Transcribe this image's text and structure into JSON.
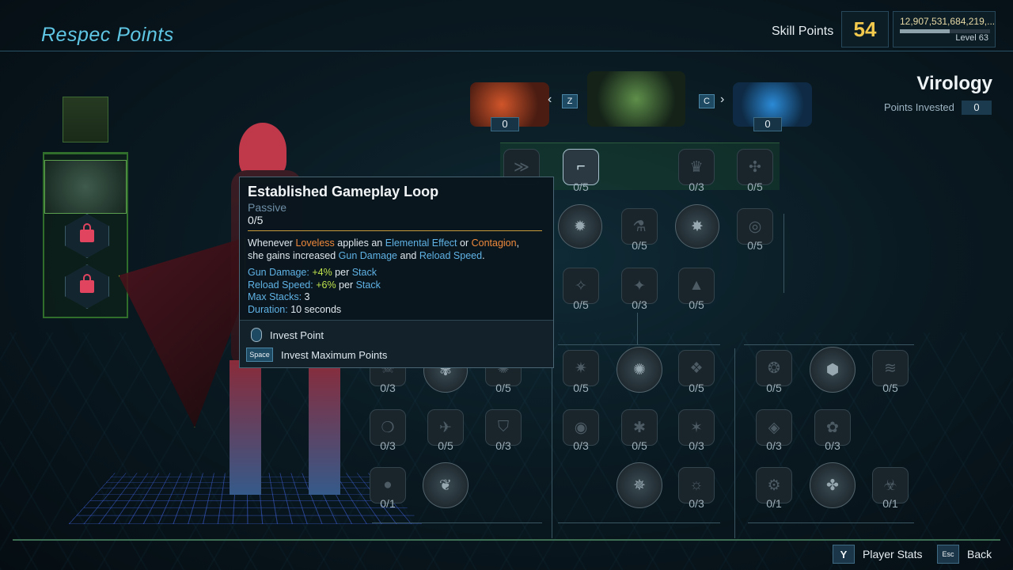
{
  "header": {
    "title": "Respec Points",
    "skill_points_label": "Skill Points",
    "skill_points_value": "54",
    "xp_value": "12,907,531,684,219,...",
    "xp_progress": 0.55,
    "level": "Level 63"
  },
  "tree": {
    "name": "Virology",
    "points_invested_label": "Points Invested",
    "points_invested_value": "0"
  },
  "action_skills": {
    "left_count": "0",
    "right_count": "0",
    "prev_key": "Z",
    "next_key": "C"
  },
  "tooltip": {
    "title": "Established Gameplay Loop",
    "type": "Passive",
    "rank": "0/5",
    "desc_1": "Whenever ",
    "desc_loveless": "Loveless",
    "desc_2": " applies an ",
    "desc_elemental": "Elemental Effect",
    "desc_3": " or ",
    "desc_contagion": "Contagion",
    "desc_4": ",",
    "desc_5": "she gains increased ",
    "desc_gun": "Gun Damage",
    "desc_6": " and ",
    "desc_reload": "Reload Speed",
    "desc_7": ".",
    "stat1_key": "Gun Damage:",
    "stat1_val": "+4%",
    "stat1_per": " per ",
    "stat1_stack": "Stack",
    "stat2_key": "Reload Speed:",
    "stat2_val": "+6%",
    "stat2_per": " per ",
    "stat2_stack": "Stack",
    "stat3_key": "Max Stacks:",
    "stat3_val": " 3",
    "stat4_key": "Duration:",
    "stat4_val": " 10 seconds",
    "invest_point": "Invest Point",
    "space_key": "Space",
    "invest_max": "Invest Maximum Points"
  },
  "nodes": [
    {
      "id": "r0a",
      "count": "0/5",
      "icon": "gun-icon",
      "glyph": "⌐"
    },
    {
      "id": "r0b",
      "count": "0/3",
      "icon": "crown-icon",
      "glyph": "♛"
    },
    {
      "id": "r0c",
      "count": "0/5",
      "icon": "triskelion-icon",
      "glyph": "✣"
    },
    {
      "id": "r1a",
      "count": "0/5",
      "icon": "flask-icon",
      "glyph": "⚗"
    },
    {
      "id": "r1b",
      "count": "0/5",
      "icon": "target-icon",
      "glyph": "◎"
    },
    {
      "id": "r2a",
      "count": "0/5",
      "icon": "compass-icon",
      "glyph": "✧"
    },
    {
      "id": "r2b",
      "count": "0/3",
      "icon": "claw-icon",
      "glyph": "✦"
    },
    {
      "id": "r2c",
      "count": "0/5",
      "icon": "flame-icon",
      "glyph": "▲"
    },
    {
      "id": "r3a",
      "count": "0/3",
      "icon": "skull-icon",
      "glyph": "☠"
    },
    {
      "id": "r3b",
      "count": "0/5",
      "icon": "burst-icon",
      "glyph": "✺"
    },
    {
      "id": "r3c",
      "count": "0/5",
      "icon": "bolt-icon",
      "glyph": "✷"
    },
    {
      "id": "r3d",
      "count": "0/5",
      "icon": "spike-icon",
      "glyph": "❖"
    },
    {
      "id": "r3e",
      "count": "0/5",
      "icon": "ring-icon",
      "glyph": "❂"
    },
    {
      "id": "r3f",
      "count": "0/5",
      "icon": "dash-icon",
      "glyph": "≋"
    },
    {
      "id": "r4a",
      "count": "0/3",
      "icon": "orb-icon",
      "glyph": "❍"
    },
    {
      "id": "r4b",
      "count": "0/5",
      "icon": "wing-icon",
      "glyph": "✈"
    },
    {
      "id": "r4c",
      "count": "0/3",
      "icon": "shield-icon",
      "glyph": "⛉"
    },
    {
      "id": "r4d",
      "count": "0/3",
      "icon": "eye-icon",
      "glyph": "◉"
    },
    {
      "id": "r4e",
      "count": "0/5",
      "icon": "drop-icon",
      "glyph": "✱"
    },
    {
      "id": "r4f",
      "count": "0/3",
      "icon": "star-icon",
      "glyph": "✶"
    },
    {
      "id": "r4g",
      "count": "0/3",
      "icon": "shard-icon",
      "glyph": "◈"
    },
    {
      "id": "r4h",
      "count": "0/3",
      "icon": "virus-icon",
      "glyph": "✿"
    },
    {
      "id": "r5a",
      "count": "0/1",
      "icon": "grenade-icon",
      "glyph": "●"
    },
    {
      "id": "r5b",
      "count": "0/3",
      "icon": "sun-icon",
      "glyph": "☼"
    },
    {
      "id": "r5c",
      "count": "0/1",
      "icon": "gear-icon",
      "glyph": "⚙"
    },
    {
      "id": "r5d",
      "count": "0/1",
      "icon": "hazard-icon",
      "glyph": "☣"
    }
  ],
  "footer": {
    "player_stats_key": "Y",
    "player_stats_label": "Player Stats",
    "back_key": "Esc",
    "back_label": "Back"
  }
}
